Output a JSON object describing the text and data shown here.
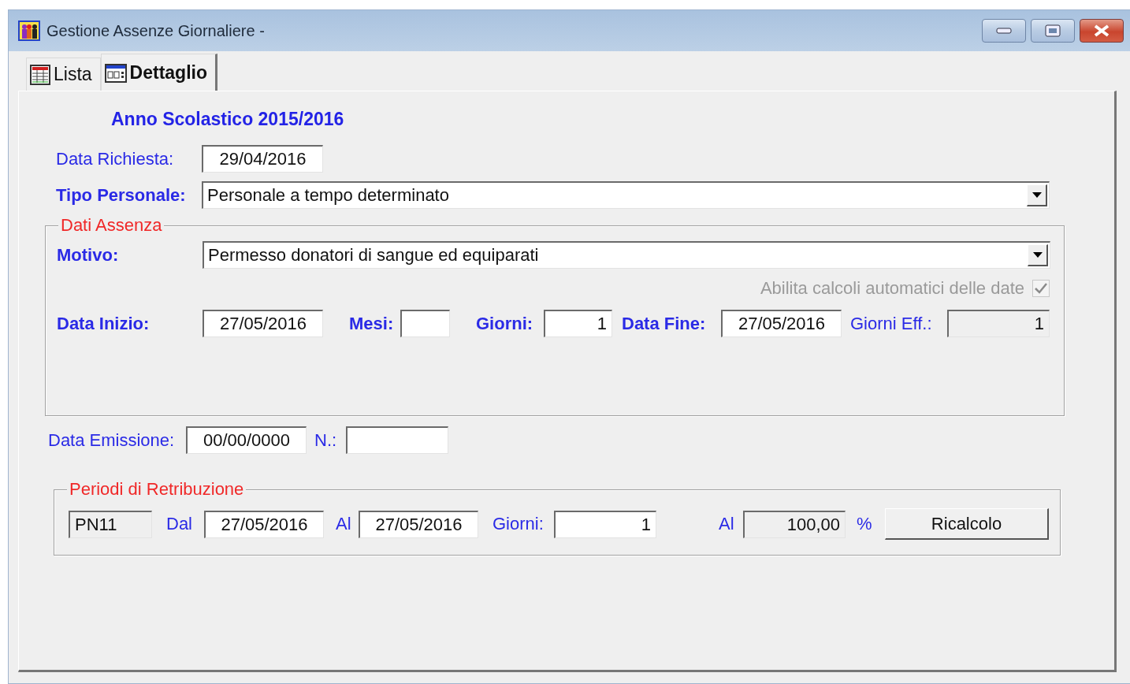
{
  "window": {
    "title": "Gestione Assenze Giornaliere -"
  },
  "tabs": [
    {
      "label": "Lista",
      "selected": false
    },
    {
      "label": "Dettaglio",
      "selected": true
    }
  ],
  "heading": "Anno Scolastico 2015/2016",
  "data_richiesta": {
    "label": "Data Richiesta:",
    "value": "29/04/2016"
  },
  "tipo_personale": {
    "label": "Tipo Personale:",
    "value": "Personale a tempo determinato"
  },
  "dati_assenza": {
    "legend": "Dati Assenza",
    "motivo": {
      "label": "Motivo:",
      "value": "Permesso donatori di sangue ed equiparati"
    },
    "auto_calc": {
      "label": "Abilita calcoli automatici delle date",
      "checked": true,
      "disabled": true
    },
    "fields": [
      {
        "label": "Data Inizio:",
        "value": "27/05/2016",
        "bold": true,
        "disabled": false
      },
      {
        "label": "Mesi:",
        "bold": true,
        "disabled": false
      },
      {
        "label": "Giorni:",
        "value": "1",
        "bold": true,
        "disabled": false
      },
      {
        "label": "Data Fine:",
        "value": "27/05/2016",
        "bold": true,
        "disabled": false
      },
      {
        "label": "Giorni Eff.:",
        "value": "1",
        "bold": false,
        "disabled": true
      }
    ]
  },
  "emissione": [
    {
      "label": "Data Emissione:",
      "value": "00/00/0000"
    },
    {
      "label": "N.:"
    }
  ],
  "periodi": {
    "legend": "Periodi di Retribuzione",
    "code": "PN11",
    "fields": [
      {
        "label": "Dal",
        "value": "27/05/2016",
        "disabled": false
      },
      {
        "label": "Al",
        "value": "27/05/2016",
        "disabled": false
      },
      {
        "label": "Giorni:",
        "value": "1",
        "disabled": false
      },
      {
        "label": "Al",
        "value": "100,00",
        "disabled": true
      }
    ],
    "unit": "%",
    "button": "Ricalcolo"
  }
}
